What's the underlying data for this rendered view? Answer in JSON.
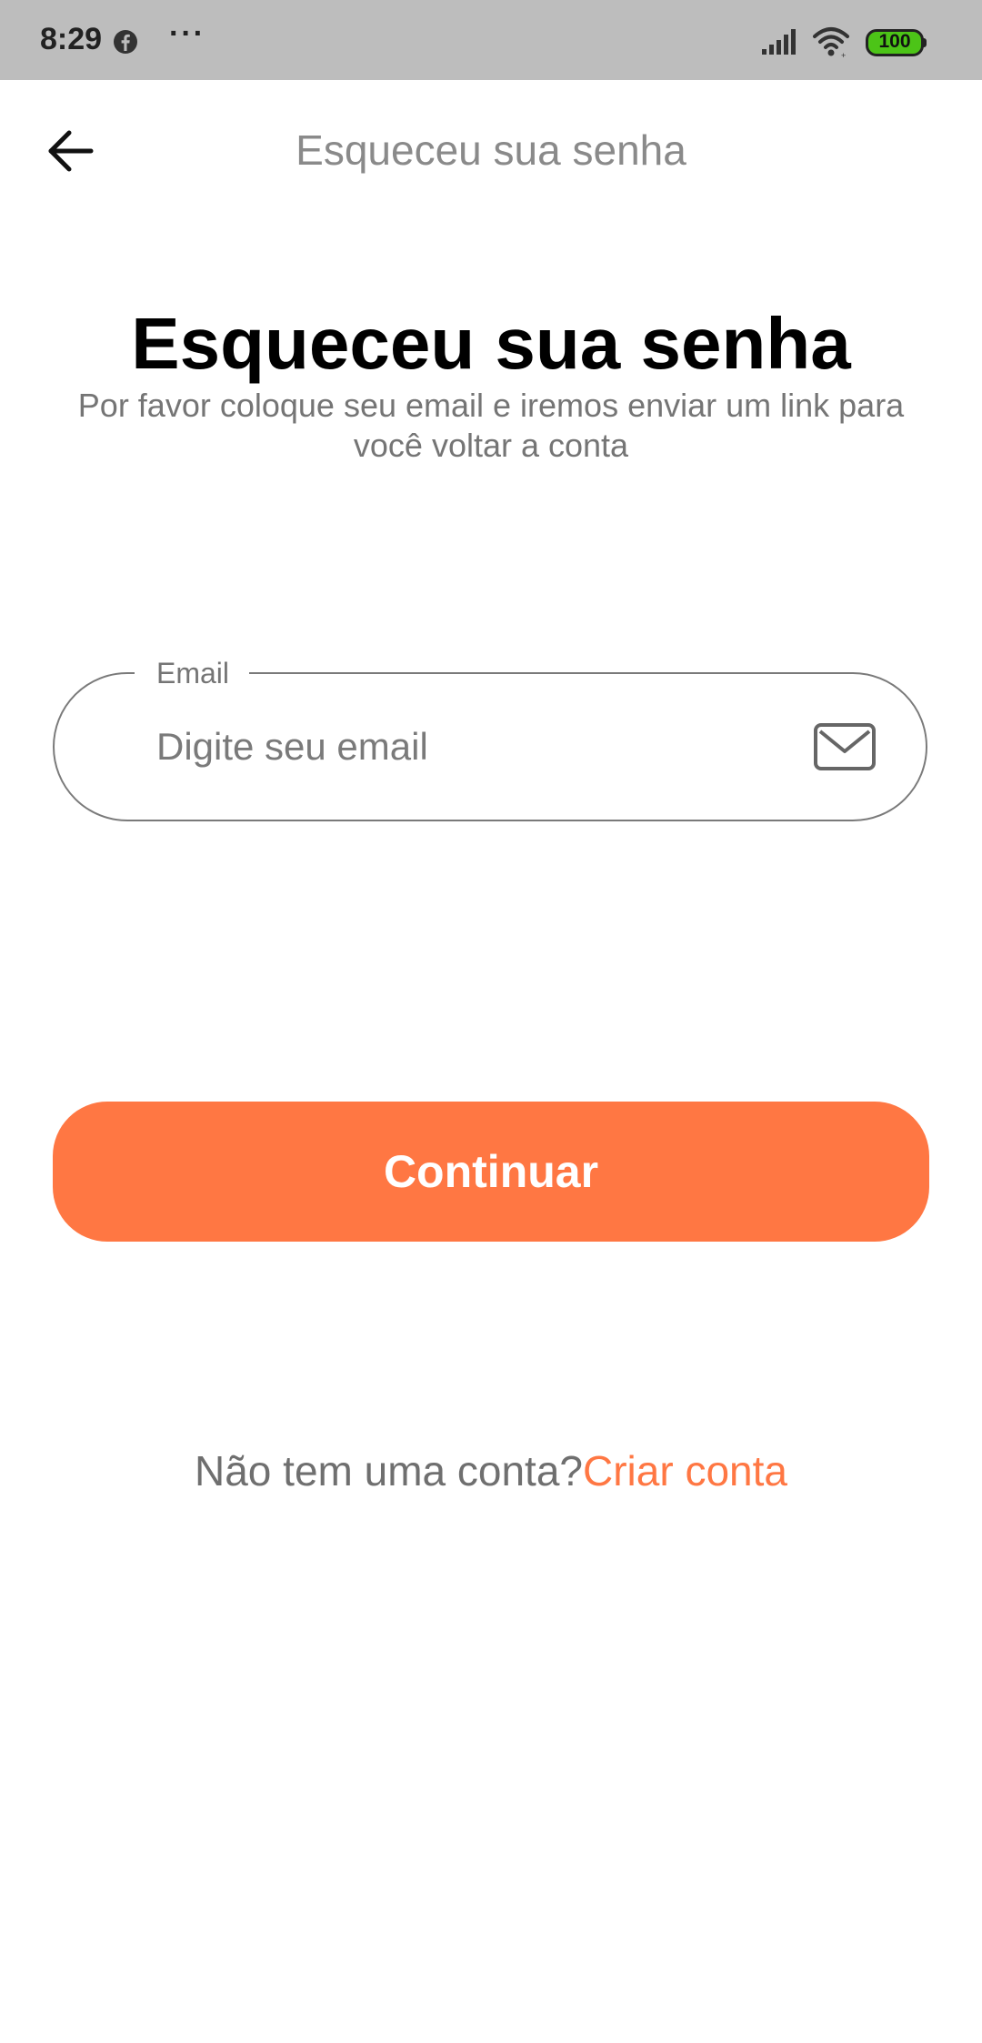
{
  "status_bar": {
    "time": "8:29",
    "overflow_dots": "···",
    "battery_level": "100",
    "battery_color": "#4cc417",
    "icons": [
      "facebook-icon",
      "signal-icon",
      "wifi-icon",
      "battery-icon"
    ]
  },
  "app_bar": {
    "back_icon": "arrow-left-icon",
    "title": "Esqueceu sua senha"
  },
  "main": {
    "heading": "Esqueceu sua senha",
    "subtitle": "Por favor coloque seu email e iremos enviar um link para você voltar a conta",
    "email_field": {
      "label": "Email",
      "placeholder": "Digite seu email",
      "value": "",
      "icon": "mail-icon"
    },
    "continue_label": "Continuar",
    "signup_prompt": "Não tem uma conta?",
    "signup_link": "Criar conta"
  },
  "colors": {
    "accent": "#ff7743",
    "status_bar_bg": "#bdbdbd",
    "muted_text": "#757575"
  }
}
